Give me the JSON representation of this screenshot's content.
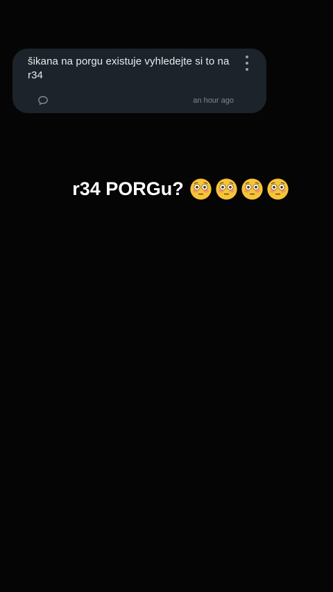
{
  "comment": {
    "text": "šikana na porgu existuje vyhledejte si to na r34",
    "timestamp": "an hour ago",
    "more_icon": "more-vertical-icon",
    "reply_icon": "comment-bubble-icon"
  },
  "caption": {
    "text": "r34 PORGu?",
    "emoji": [
      "flushed-face-emoji",
      "flushed-face-emoji",
      "flushed-face-emoji",
      "flushed-face-emoji"
    ]
  },
  "colors": {
    "background": "#050505",
    "card": "#1c232b",
    "text": "#e9ecef",
    "muted": "#7e8790",
    "caption": "#ffffff",
    "emoji_face": "#f7c437"
  }
}
